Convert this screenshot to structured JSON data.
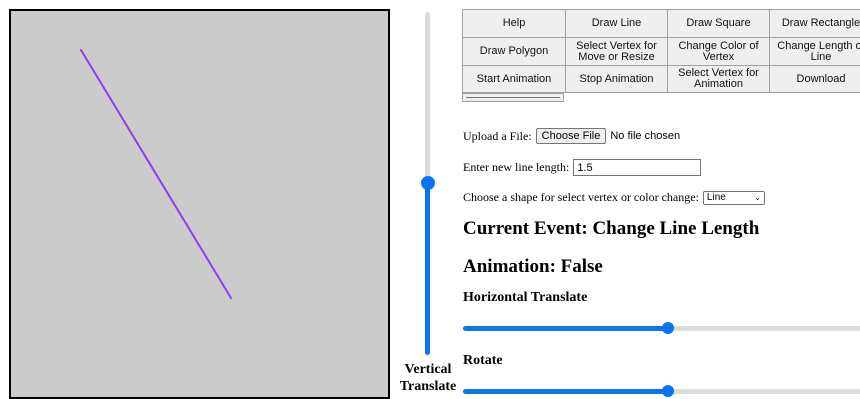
{
  "canvas": {
    "line_color": "#8f3df0",
    "background": "#cbcbcb"
  },
  "vertical_slider": {
    "label_line1": "Vertical",
    "label_line2": "Translate",
    "value_fraction": 0.5,
    "color": "#0b74f0"
  },
  "buttons": [
    "Help",
    "Draw Line",
    "Draw Square",
    "Draw Rectangle",
    "Draw Polygon",
    "Select Vertex for Move or Resize",
    "Change Color of Vertex",
    "Change Length of Line",
    "Start Animation",
    "Stop Animation",
    "Select Vertex for Animation",
    "Download"
  ],
  "upload": {
    "label": "Upload a File:",
    "button": "Choose File",
    "status": "No file chosen"
  },
  "line_length": {
    "label": "Enter new line length:",
    "value": "1.5"
  },
  "shape_select": {
    "label": "Choose a shape for select vertex or color change:",
    "selected": "Line"
  },
  "current_event": "Current Event: Change Line Length",
  "animation_status": "Animation: False",
  "horizontal_translate": {
    "label": "Horizontal Translate",
    "value_fraction": 0.5
  },
  "rotate": {
    "label": "Rotate",
    "value_fraction": 0.5
  }
}
